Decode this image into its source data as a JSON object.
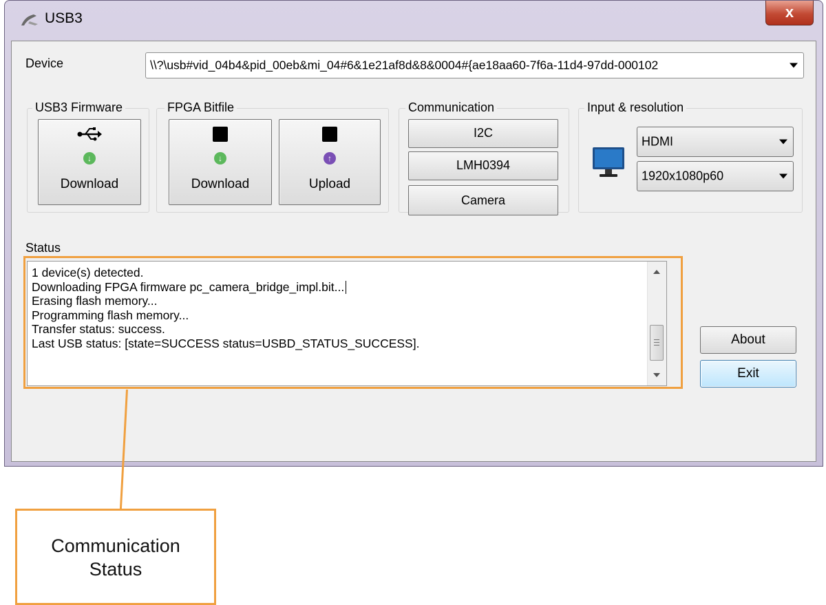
{
  "window": {
    "title": "USB3",
    "close_label": "x"
  },
  "device": {
    "label": "Device",
    "value": "\\\\?\\usb#vid_04b4&pid_00eb&mi_04#6&1e21af8d&8&0004#{ae18aa60-7f6a-11d4-97dd-000102"
  },
  "firmware_group": {
    "label": "USB3 Firmware",
    "download_label": "Download"
  },
  "fpga_group": {
    "label": "FPGA Bitfile",
    "download_label": "Download",
    "upload_label": "Upload"
  },
  "communication_group": {
    "label": "Communication",
    "buttons": [
      "I2C",
      "LMH0394",
      "Camera"
    ]
  },
  "input_group": {
    "label": "Input & resolution",
    "source": "HDMI",
    "resolution": "1920x1080p60"
  },
  "status": {
    "label": "Status",
    "lines": [
      "1 device(s) detected.",
      "Downloading FPGA firmware pc_camera_bridge_impl.bit...",
      "Erasing flash memory...",
      "Programming flash memory...",
      "Transfer status: success.",
      "Last USB status: [state=SUCCESS status=USBD_STATUS_SUCCESS]."
    ]
  },
  "actions": {
    "about_label": "About",
    "exit_label": "Exit"
  },
  "callout": {
    "line1": "Communication",
    "line2": "Status"
  },
  "colors": {
    "callout_border": "#f0a040",
    "close_button": "#c24a34"
  }
}
